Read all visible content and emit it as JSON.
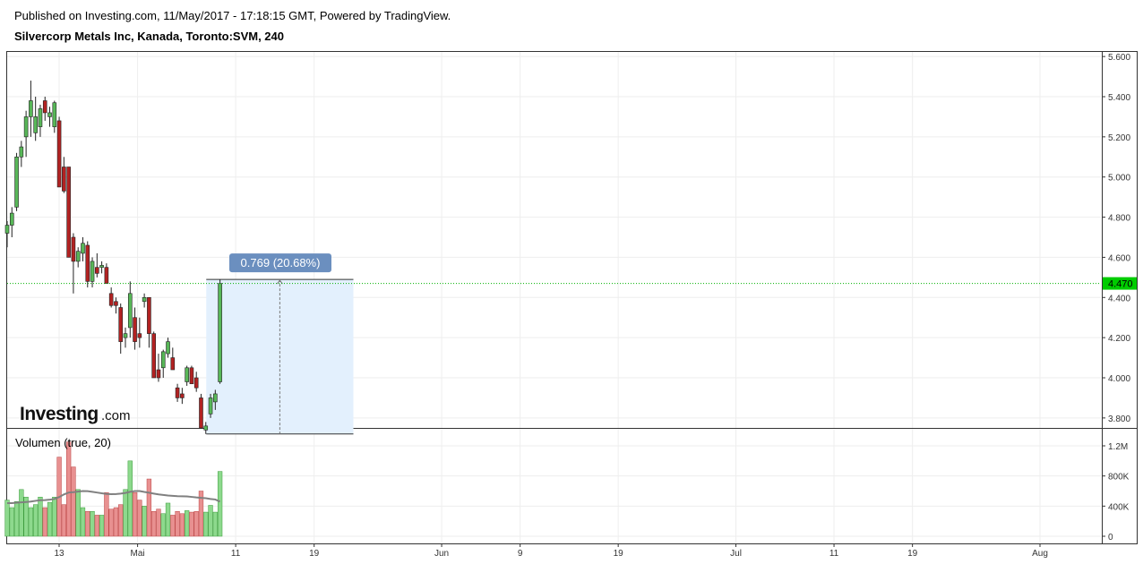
{
  "header": {
    "published": "Published on Investing.com, 11/May/2017 - 17:18:15 GMT, Powered by TradingView.",
    "symbol": "Silvercorp Metals Inc, Kanada, Toronto:SVM, 240"
  },
  "logo": {
    "brand": "Investing",
    "suffix": ".com"
  },
  "colors": {
    "up": "#58b758",
    "down": "#b22222",
    "vol_up": "#8dd98d",
    "vol_down": "#e89090",
    "ma": "#808080",
    "grid": "#eeeeee",
    "price_line": "#00b000",
    "range_fill": "#e3f0fd",
    "badge": "#6b8fbf"
  },
  "chart_data": {
    "type": "candlestick",
    "price_axis": {
      "ticks": [
        "5.600",
        "5.400",
        "5.200",
        "5.000",
        "4.800",
        "4.600",
        "4.400",
        "4.200",
        "4.000",
        "3.800"
      ],
      "range": [
        3.65,
        5.7
      ]
    },
    "volume_panel": {
      "title": "Volumen (true, 20)",
      "ticks": [
        "1.2M",
        "800K",
        "400K",
        "0"
      ],
      "range": [
        0,
        1300000
      ]
    },
    "x_axis": {
      "labels": [
        {
          "label": "13",
          "day": 13
        },
        {
          "label": "Mai",
          "day": 21
        },
        {
          "label": "11",
          "day": 31
        },
        {
          "label": "19",
          "day": 39
        },
        {
          "label": "Jun",
          "day": 52
        },
        {
          "label": "9",
          "day": 60
        },
        {
          "label": "19",
          "day": 70
        },
        {
          "label": "Jul",
          "day": 82
        },
        {
          "label": "11",
          "day": 92
        },
        {
          "label": "19",
          "day": 100
        },
        {
          "label": "Aug",
          "day": 113
        }
      ]
    },
    "last_price": "4.470",
    "measure": {
      "label": "0.769 (20.68%)",
      "from_day": 28,
      "to_day": 43,
      "low": 3.72,
      "high": 4.49
    },
    "candles": [
      [
        4.72,
        4.78,
        4.65,
        4.76,
        480000
      ],
      [
        4.76,
        4.85,
        4.7,
        4.82,
        380000
      ],
      [
        4.85,
        5.12,
        4.83,
        5.1,
        460000
      ],
      [
        5.1,
        5.18,
        5.05,
        5.15,
        620000
      ],
      [
        5.2,
        5.33,
        5.1,
        5.3,
        520000
      ],
      [
        5.3,
        5.48,
        5.2,
        5.38,
        380000
      ],
      [
        5.22,
        5.4,
        5.18,
        5.3,
        420000
      ],
      [
        5.25,
        5.36,
        5.2,
        5.34,
        520000
      ],
      [
        5.38,
        5.4,
        5.28,
        5.32,
        380000
      ],
      [
        5.3,
        5.35,
        5.25,
        5.32,
        450000
      ],
      [
        5.25,
        5.38,
        5.22,
        5.37,
        520000
      ],
      [
        5.28,
        5.3,
        4.95,
        4.95,
        1050000
      ],
      [
        5.05,
        5.1,
        4.92,
        4.93,
        420000
      ],
      [
        5.05,
        5.05,
        4.6,
        4.6,
        1250000
      ],
      [
        4.7,
        4.72,
        4.42,
        4.58,
        920000
      ],
      [
        4.58,
        4.65,
        4.55,
        4.63,
        620000
      ],
      [
        4.62,
        4.7,
        4.58,
        4.67,
        380000
      ],
      [
        4.66,
        4.68,
        4.45,
        4.48,
        330000
      ],
      [
        4.48,
        4.6,
        4.45,
        4.58,
        330000
      ],
      [
        4.55,
        4.62,
        4.5,
        4.52,
        280000
      ],
      [
        4.55,
        4.58,
        4.52,
        4.56,
        280000
      ],
      [
        4.55,
        4.57,
        4.48,
        4.47,
        580000
      ],
      [
        4.42,
        4.45,
        4.35,
        4.36,
        360000
      ],
      [
        4.38,
        4.4,
        4.32,
        4.36,
        380000
      ],
      [
        4.35,
        4.37,
        4.12,
        4.18,
        420000
      ],
      [
        4.2,
        4.25,
        4.15,
        4.22,
        620000
      ],
      [
        4.25,
        4.48,
        4.2,
        4.42,
        1000000
      ],
      [
        4.3,
        4.35,
        4.14,
        4.18,
        580000
      ],
      [
        4.22,
        4.3,
        4.15,
        4.2,
        480000
      ],
      [
        4.38,
        4.42,
        4.35,
        4.4,
        400000
      ],
      [
        4.4,
        4.4,
        4.15,
        4.22,
        760000
      ],
      [
        4.22,
        4.23,
        4.0,
        4.0,
        330000
      ],
      [
        4.04,
        4.12,
        3.98,
        4.0,
        360000
      ],
      [
        4.05,
        4.14,
        4.0,
        4.13,
        300000
      ],
      [
        4.12,
        4.2,
        4.1,
        4.18,
        440000
      ],
      [
        4.1,
        4.15,
        4.04,
        4.04,
        280000
      ],
      [
        3.95,
        3.97,
        3.88,
        3.9,
        330000
      ],
      [
        3.92,
        3.95,
        3.87,
        3.9,
        300000
      ],
      [
        3.98,
        4.06,
        3.96,
        4.05,
        340000
      ],
      [
        4.05,
        4.06,
        3.97,
        3.97,
        320000
      ],
      [
        4.0,
        4.03,
        3.93,
        3.95,
        330000
      ],
      [
        3.9,
        3.92,
        3.75,
        3.75,
        600000
      ],
      [
        3.74,
        3.78,
        3.72,
        3.76,
        320000
      ],
      [
        3.82,
        3.92,
        3.8,
        3.9,
        410000
      ],
      [
        3.88,
        3.94,
        3.84,
        3.92,
        320000
      ],
      [
        3.98,
        4.49,
        3.97,
        4.47,
        860000
      ]
    ],
    "volume_ma": [
      440000,
      440000,
      445000,
      450000,
      455000,
      460000,
      470000,
      478000,
      480000,
      485000,
      495000,
      520000,
      555000,
      580000,
      585000,
      592000,
      600000,
      598000,
      590000,
      580000,
      570000,
      562000,
      558000,
      560000,
      566000,
      575000,
      590000,
      600000,
      600000,
      588000,
      578000,
      566000,
      555000,
      548000,
      540000,
      536000,
      532000,
      530000,
      528000,
      522000,
      515000,
      510000,
      505000,
      495000,
      488000,
      460000
    ]
  }
}
